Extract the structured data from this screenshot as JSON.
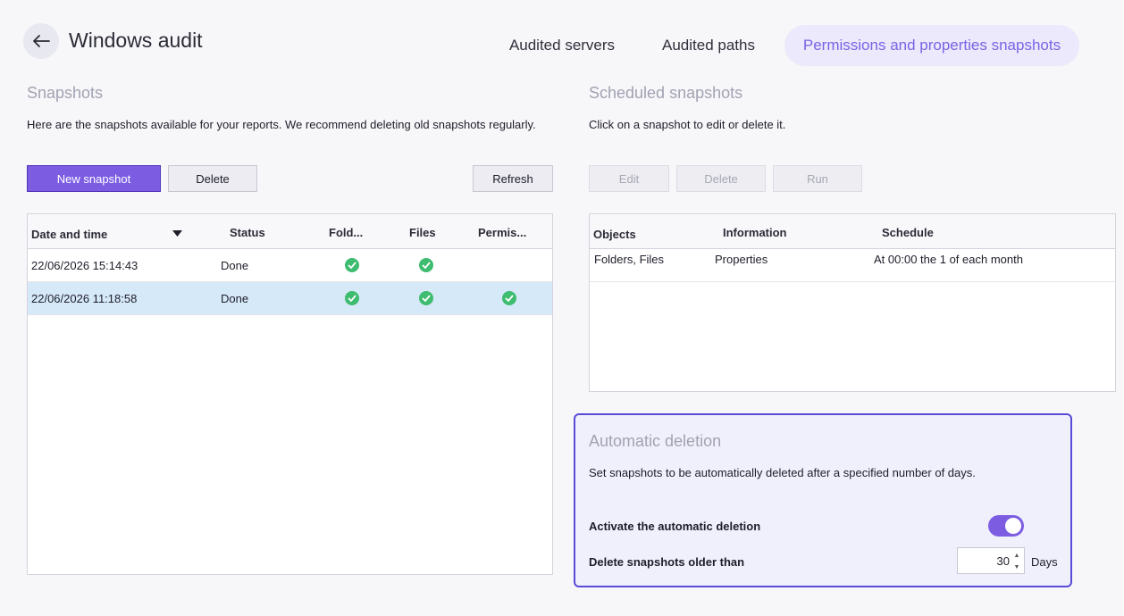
{
  "header": {
    "title": "Windows audit",
    "tabs": [
      {
        "label": "Audited servers",
        "active": false
      },
      {
        "label": "Audited paths",
        "active": false
      },
      {
        "label": "Permissions and properties snapshots",
        "active": true
      }
    ]
  },
  "snapshots": {
    "title": "Snapshots",
    "description": "Here are the snapshots available for your reports. We recommend deleting old snapshots regularly.",
    "buttons": {
      "new": "New snapshot",
      "delete": "Delete",
      "refresh": "Refresh"
    },
    "columns": [
      "Date and time",
      "Status",
      "Fold...",
      "Files",
      "Permis..."
    ],
    "rows": [
      {
        "date": "22/06/2026 15:14:43",
        "status": "Done",
        "folders": true,
        "files": true,
        "permissions": false,
        "selected": false
      },
      {
        "date": "22/06/2026 11:18:58",
        "status": "Done",
        "folders": true,
        "files": true,
        "permissions": true,
        "selected": true
      }
    ]
  },
  "scheduled": {
    "title": "Scheduled snapshots",
    "description": "Click on a snapshot to edit or delete it.",
    "buttons": {
      "edit": "Edit",
      "delete": "Delete",
      "run": "Run"
    },
    "columns": [
      "Objects",
      "Information",
      "Schedule"
    ],
    "rows": [
      {
        "objects": "Folders, Files",
        "information": "Properties",
        "schedule": "At 00:00 the 1 of each month"
      }
    ]
  },
  "auto_deletion": {
    "title": "Automatic deletion",
    "description": "Set snapshots to be automatically deleted after a specified number of days.",
    "activate_label": "Activate the automatic deletion",
    "activate_enabled": true,
    "older_than_label": "Delete snapshots older than",
    "days_value": "30",
    "days_unit": "Days"
  },
  "colors": {
    "accent": "#7c5de2",
    "tab_active_bg": "#ebe9fb",
    "selected_row": "#d6e9f8",
    "check": "#3ebc6f",
    "box_border": "#5a4ad8"
  }
}
